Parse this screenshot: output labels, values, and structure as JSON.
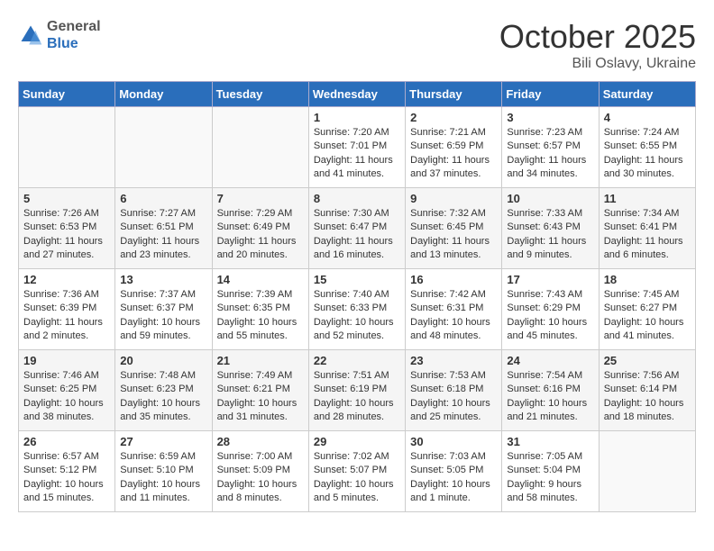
{
  "header": {
    "logo": {
      "general": "General",
      "blue": "Blue"
    },
    "title": "October 2025",
    "subtitle": "Bili Oslavy, Ukraine"
  },
  "weekdays": [
    "Sunday",
    "Monday",
    "Tuesday",
    "Wednesday",
    "Thursday",
    "Friday",
    "Saturday"
  ],
  "weeks": [
    [
      {
        "day": "",
        "info": ""
      },
      {
        "day": "",
        "info": ""
      },
      {
        "day": "",
        "info": ""
      },
      {
        "day": "1",
        "info": "Sunrise: 7:20 AM\nSunset: 7:01 PM\nDaylight: 11 hours\nand 41 minutes."
      },
      {
        "day": "2",
        "info": "Sunrise: 7:21 AM\nSunset: 6:59 PM\nDaylight: 11 hours\nand 37 minutes."
      },
      {
        "day": "3",
        "info": "Sunrise: 7:23 AM\nSunset: 6:57 PM\nDaylight: 11 hours\nand 34 minutes."
      },
      {
        "day": "4",
        "info": "Sunrise: 7:24 AM\nSunset: 6:55 PM\nDaylight: 11 hours\nand 30 minutes."
      }
    ],
    [
      {
        "day": "5",
        "info": "Sunrise: 7:26 AM\nSunset: 6:53 PM\nDaylight: 11 hours\nand 27 minutes."
      },
      {
        "day": "6",
        "info": "Sunrise: 7:27 AM\nSunset: 6:51 PM\nDaylight: 11 hours\nand 23 minutes."
      },
      {
        "day": "7",
        "info": "Sunrise: 7:29 AM\nSunset: 6:49 PM\nDaylight: 11 hours\nand 20 minutes."
      },
      {
        "day": "8",
        "info": "Sunrise: 7:30 AM\nSunset: 6:47 PM\nDaylight: 11 hours\nand 16 minutes."
      },
      {
        "day": "9",
        "info": "Sunrise: 7:32 AM\nSunset: 6:45 PM\nDaylight: 11 hours\nand 13 minutes."
      },
      {
        "day": "10",
        "info": "Sunrise: 7:33 AM\nSunset: 6:43 PM\nDaylight: 11 hours\nand 9 minutes."
      },
      {
        "day": "11",
        "info": "Sunrise: 7:34 AM\nSunset: 6:41 PM\nDaylight: 11 hours\nand 6 minutes."
      }
    ],
    [
      {
        "day": "12",
        "info": "Sunrise: 7:36 AM\nSunset: 6:39 PM\nDaylight: 11 hours\nand 2 minutes."
      },
      {
        "day": "13",
        "info": "Sunrise: 7:37 AM\nSunset: 6:37 PM\nDaylight: 10 hours\nand 59 minutes."
      },
      {
        "day": "14",
        "info": "Sunrise: 7:39 AM\nSunset: 6:35 PM\nDaylight: 10 hours\nand 55 minutes."
      },
      {
        "day": "15",
        "info": "Sunrise: 7:40 AM\nSunset: 6:33 PM\nDaylight: 10 hours\nand 52 minutes."
      },
      {
        "day": "16",
        "info": "Sunrise: 7:42 AM\nSunset: 6:31 PM\nDaylight: 10 hours\nand 48 minutes."
      },
      {
        "day": "17",
        "info": "Sunrise: 7:43 AM\nSunset: 6:29 PM\nDaylight: 10 hours\nand 45 minutes."
      },
      {
        "day": "18",
        "info": "Sunrise: 7:45 AM\nSunset: 6:27 PM\nDaylight: 10 hours\nand 41 minutes."
      }
    ],
    [
      {
        "day": "19",
        "info": "Sunrise: 7:46 AM\nSunset: 6:25 PM\nDaylight: 10 hours\nand 38 minutes."
      },
      {
        "day": "20",
        "info": "Sunrise: 7:48 AM\nSunset: 6:23 PM\nDaylight: 10 hours\nand 35 minutes."
      },
      {
        "day": "21",
        "info": "Sunrise: 7:49 AM\nSunset: 6:21 PM\nDaylight: 10 hours\nand 31 minutes."
      },
      {
        "day": "22",
        "info": "Sunrise: 7:51 AM\nSunset: 6:19 PM\nDaylight: 10 hours\nand 28 minutes."
      },
      {
        "day": "23",
        "info": "Sunrise: 7:53 AM\nSunset: 6:18 PM\nDaylight: 10 hours\nand 25 minutes."
      },
      {
        "day": "24",
        "info": "Sunrise: 7:54 AM\nSunset: 6:16 PM\nDaylight: 10 hours\nand 21 minutes."
      },
      {
        "day": "25",
        "info": "Sunrise: 7:56 AM\nSunset: 6:14 PM\nDaylight: 10 hours\nand 18 minutes."
      }
    ],
    [
      {
        "day": "26",
        "info": "Sunrise: 6:57 AM\nSunset: 5:12 PM\nDaylight: 10 hours\nand 15 minutes."
      },
      {
        "day": "27",
        "info": "Sunrise: 6:59 AM\nSunset: 5:10 PM\nDaylight: 10 hours\nand 11 minutes."
      },
      {
        "day": "28",
        "info": "Sunrise: 7:00 AM\nSunset: 5:09 PM\nDaylight: 10 hours\nand 8 minutes."
      },
      {
        "day": "29",
        "info": "Sunrise: 7:02 AM\nSunset: 5:07 PM\nDaylight: 10 hours\nand 5 minutes."
      },
      {
        "day": "30",
        "info": "Sunrise: 7:03 AM\nSunset: 5:05 PM\nDaylight: 10 hours\nand 1 minute."
      },
      {
        "day": "31",
        "info": "Sunrise: 7:05 AM\nSunset: 5:04 PM\nDaylight: 9 hours\nand 58 minutes."
      },
      {
        "day": "",
        "info": ""
      }
    ]
  ]
}
